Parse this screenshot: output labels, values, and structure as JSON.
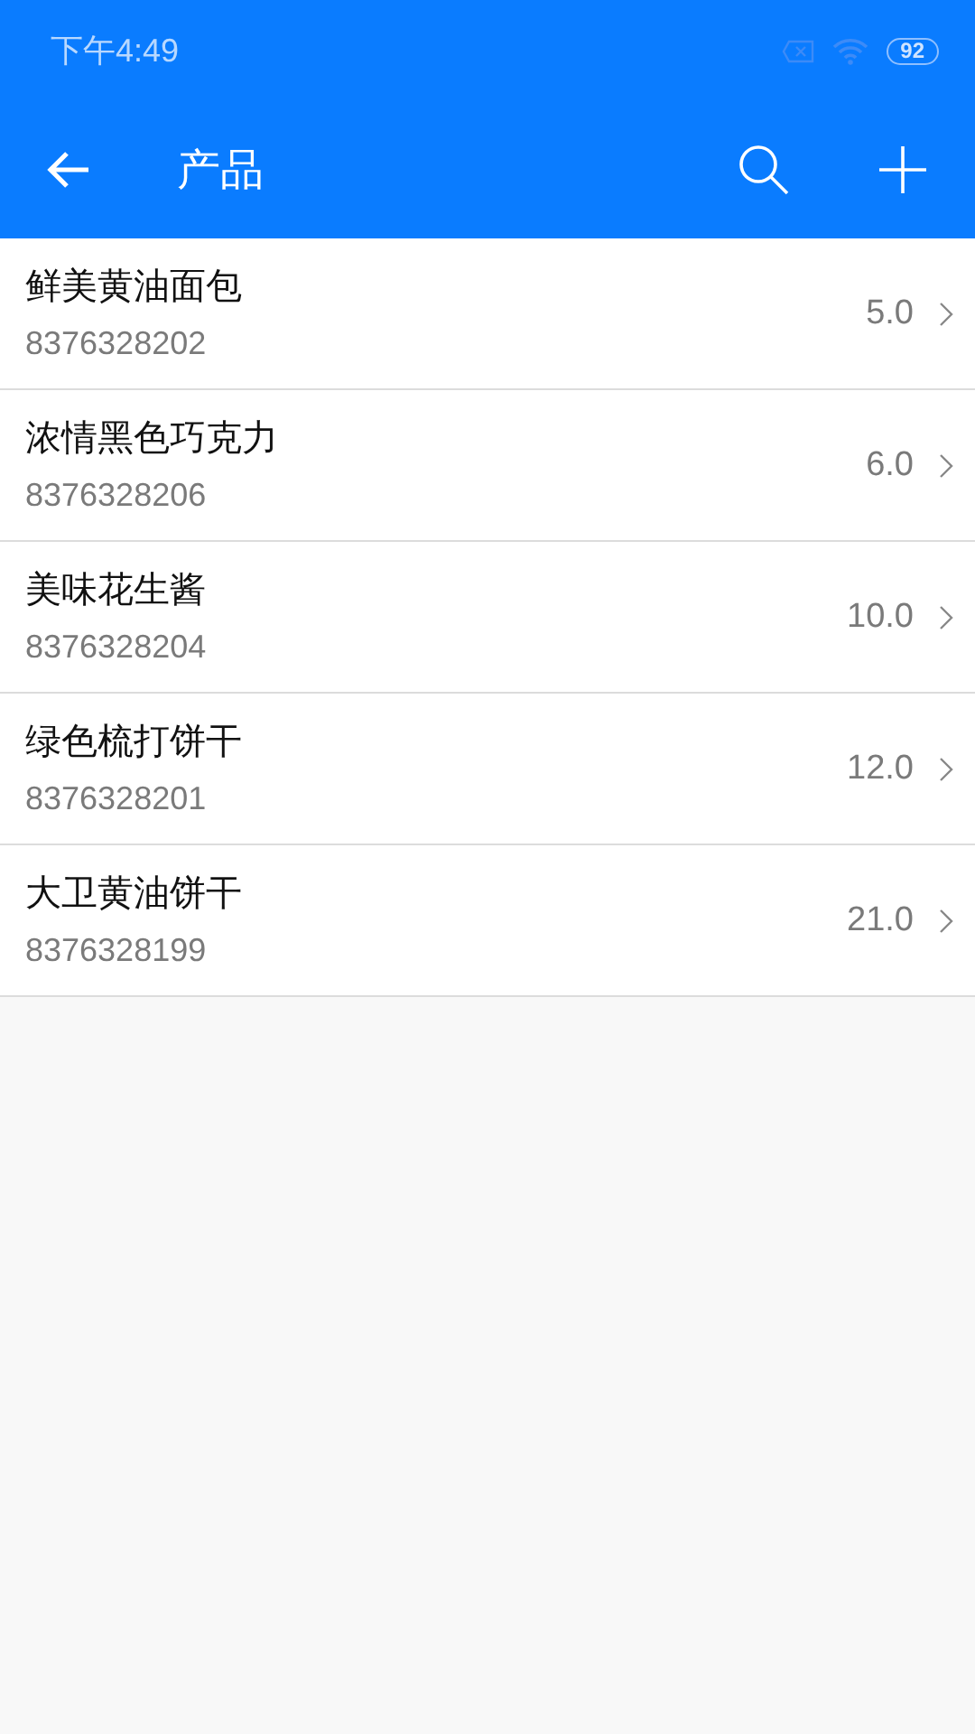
{
  "status_bar": {
    "time": "下午4:49",
    "battery": "92"
  },
  "toolbar": {
    "title": "产品"
  },
  "products": [
    {
      "name": "鲜美黄油面包",
      "code": "8376328202",
      "price": "5.0"
    },
    {
      "name": "浓情黑色巧克力",
      "code": "8376328206",
      "price": "6.0"
    },
    {
      "name": "美味花生酱",
      "code": "8376328204",
      "price": "10.0"
    },
    {
      "name": "绿色梳打饼干",
      "code": "8376328201",
      "price": "12.0"
    },
    {
      "name": "大卫黄油饼干",
      "code": "8376328199",
      "price": "21.0"
    }
  ]
}
